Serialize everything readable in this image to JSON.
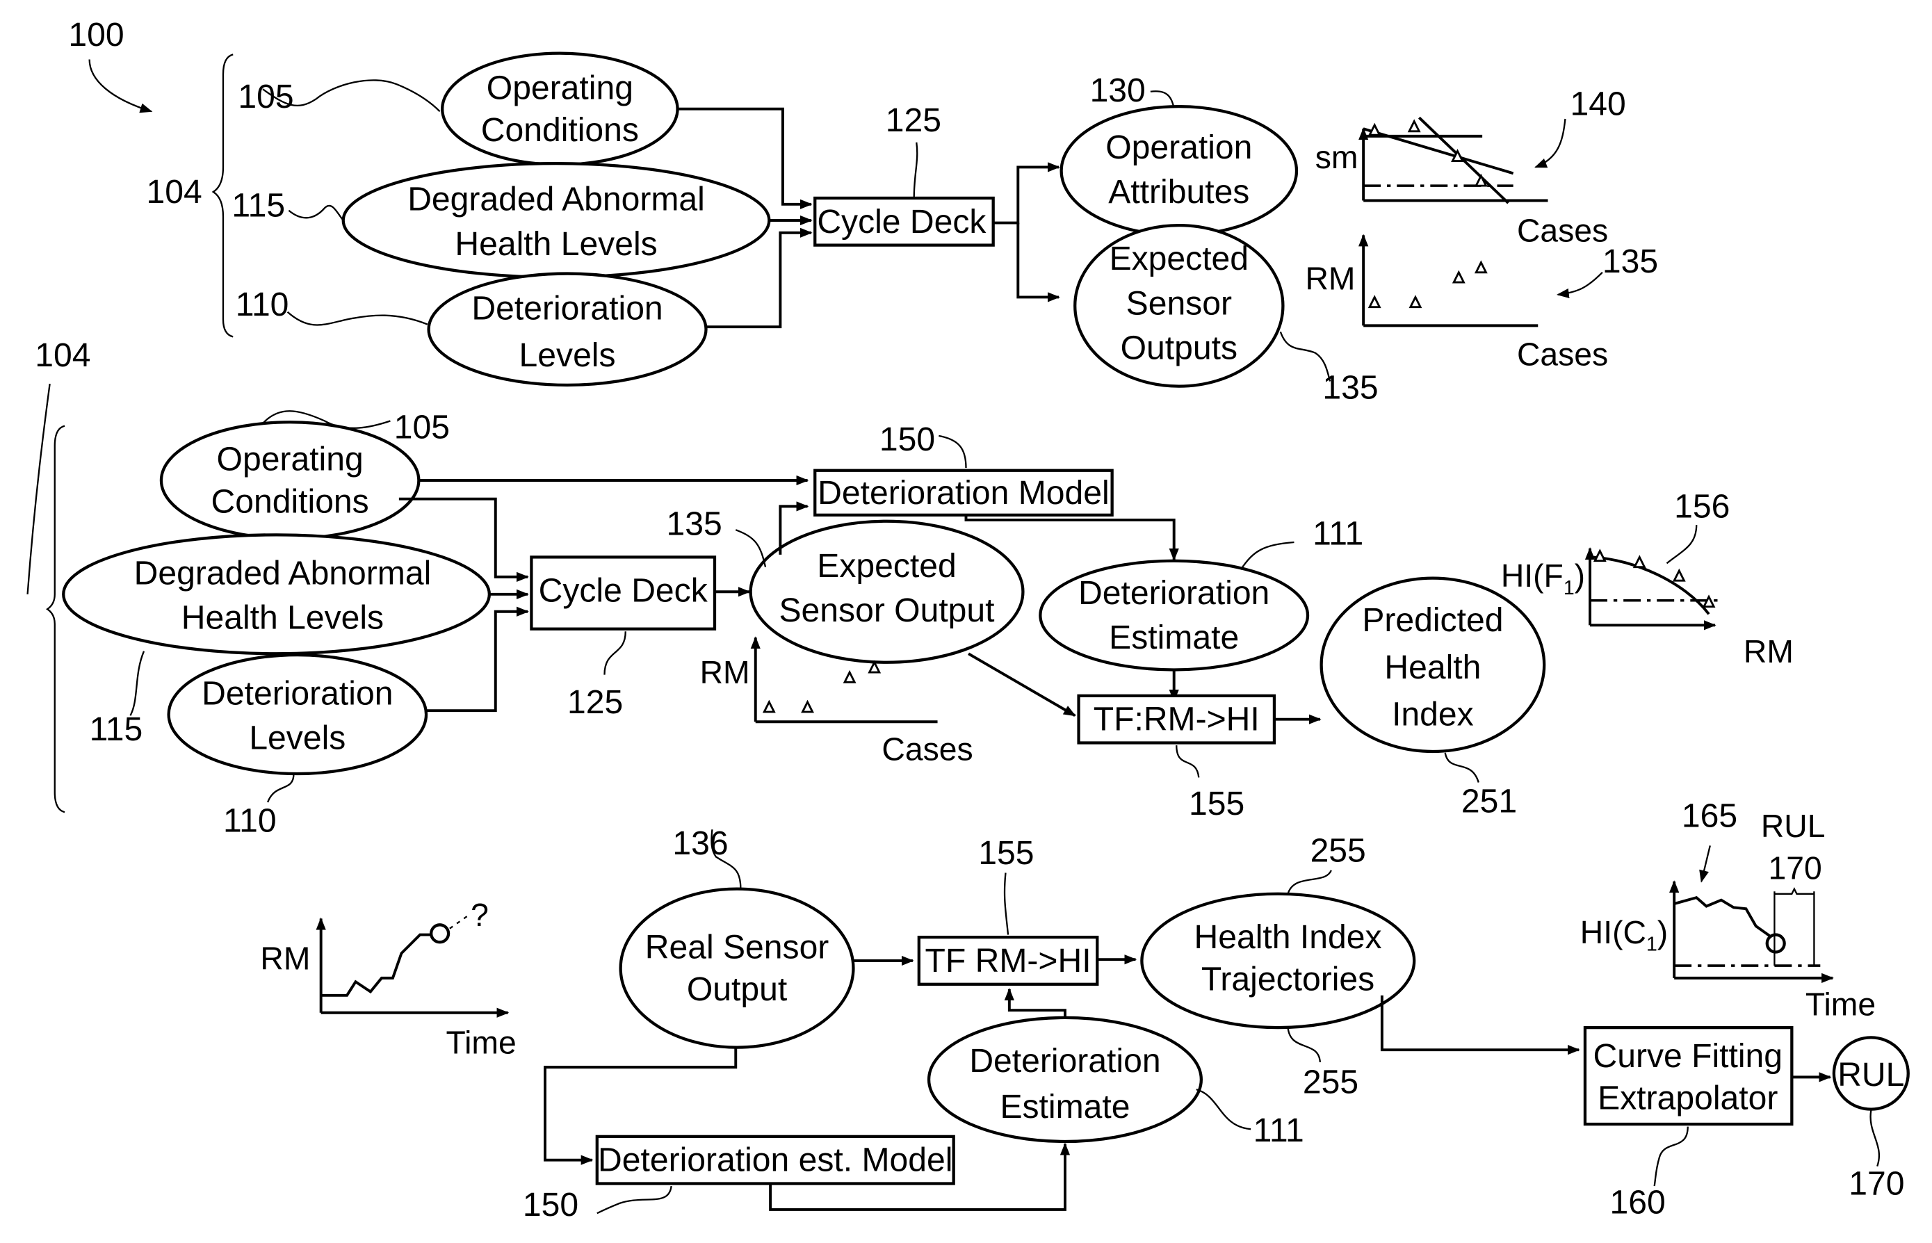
{
  "figure": {
    "ref": "100"
  },
  "section_top": {
    "group_ref": "104",
    "inputs": [
      {
        "ref": "105",
        "lines": [
          "Operating",
          "Conditions"
        ]
      },
      {
        "ref": "115",
        "lines": [
          "Degraded Abnormal",
          "Health Levels"
        ]
      },
      {
        "ref": "110",
        "lines": [
          "Deterioration",
          "Levels"
        ]
      }
    ],
    "cycle_deck": {
      "ref": "125",
      "label": "Cycle Deck"
    },
    "operation_attributes": {
      "ref": "130",
      "lines": [
        "Operation",
        "Attributes"
      ]
    },
    "expected_sensor_outputs": {
      "ref": "135",
      "lines": [
        "Expected",
        "Sensor",
        "Outputs"
      ]
    },
    "chart_sm": {
      "ref": "140",
      "ylabel": "sm",
      "xlabel": "Cases"
    },
    "chart_rm": {
      "ref": "135",
      "ylabel": "RM",
      "xlabel": "Cases"
    }
  },
  "section_middle": {
    "group_ref": "104",
    "inputs": [
      {
        "ref": "105",
        "lines": [
          "Operating",
          "Conditions"
        ]
      },
      {
        "ref": "115",
        "lines": [
          "Degraded Abnormal",
          "Health Levels"
        ]
      },
      {
        "ref": "110",
        "lines": [
          "Deterioration",
          "Levels"
        ]
      }
    ],
    "cycle_deck": {
      "ref": "125",
      "label": "Cycle Deck"
    },
    "deterioration_model": {
      "ref": "150",
      "label": "Deterioration Model"
    },
    "expected_sensor_output": {
      "ref": "135",
      "lines": [
        "Expected",
        "Sensor Output"
      ]
    },
    "deterioration_estimate": {
      "ref": "111",
      "lines": [
        "Deterioration",
        "Estimate"
      ]
    },
    "transfer_function": {
      "ref": "155",
      "label": "TF:RM->HI"
    },
    "predicted_health_index": {
      "ref": "251",
      "lines": [
        "Predicted",
        "Health",
        "Index"
      ]
    },
    "chart_rm": {
      "ylabel": "RM",
      "xlabel": "Cases"
    },
    "chart_hi": {
      "ref": "156",
      "ylabel": "HI(F",
      "ylabel_sub": "1",
      "ylabel_end": ")",
      "xlabel": "RM"
    }
  },
  "section_bottom": {
    "chart_rm_time": {
      "ylabel": "RM",
      "xlabel": "Time",
      "annotation": "?"
    },
    "real_sensor_output": {
      "ref": "136",
      "lines": [
        "Real Sensor",
        "Output"
      ]
    },
    "transfer_function": {
      "ref": "155",
      "label": "TF RM->HI"
    },
    "health_index_trajectories": {
      "ref": "255",
      "ref2": "255",
      "lines": [
        "Health Index",
        "Trajectories"
      ]
    },
    "deterioration_estimate": {
      "ref": "111",
      "lines": [
        "Deterioration",
        "Estimate"
      ]
    },
    "deterioration_est_model": {
      "ref": "150",
      "label": "Deterioration est. Model"
    },
    "curve_fitting": {
      "ref": "160",
      "lines": [
        "Curve Fitting",
        "Extrapolator"
      ]
    },
    "rul_output": {
      "ref": "170",
      "label": "RUL"
    },
    "chart_hi_time": {
      "ref": "165",
      "ylabel": "HI(C",
      "ylabel_sub": "1",
      "ylabel_end": ")",
      "xlabel": "Time",
      "rul_label": "RUL",
      "rul_ref": "170"
    }
  }
}
